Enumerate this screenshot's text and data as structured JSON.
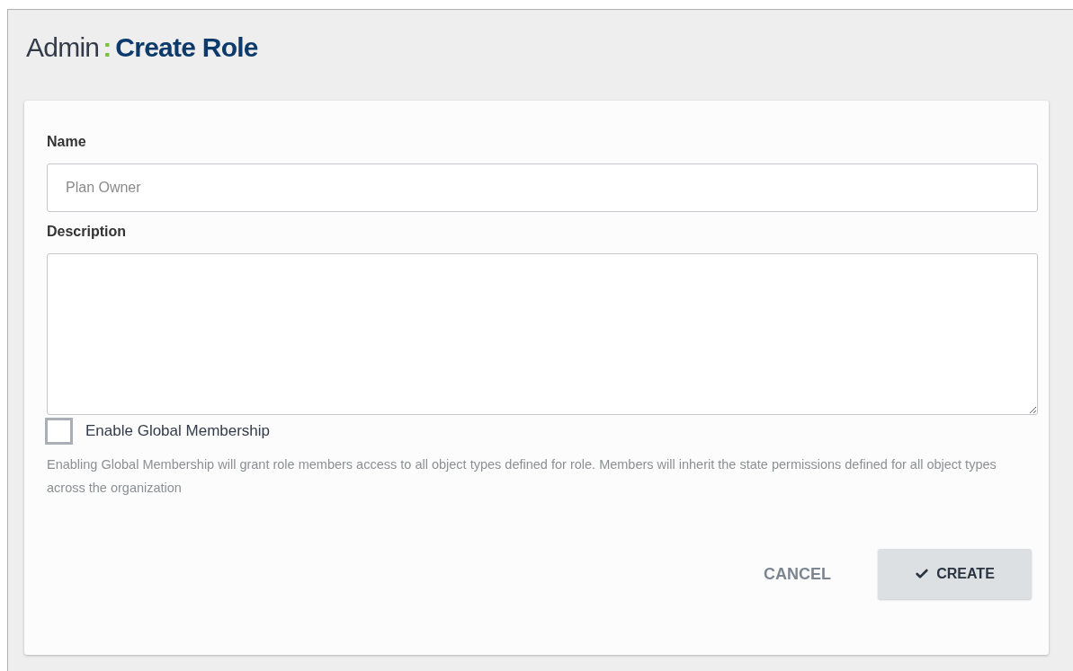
{
  "header": {
    "section": "Admin",
    "separator": ":",
    "title": "Create Role"
  },
  "form": {
    "name_field": {
      "label": "Name",
      "placeholder": "Plan Owner"
    },
    "description_field": {
      "label": "Description"
    },
    "global_membership": {
      "label": "Enable Global Membership",
      "checked": false,
      "help": "Enabling Global Membership will grant role members access to all object types defined for role. Members will inherit the state permissions defined for all object types across the organization"
    },
    "buttons": [
      {
        "kind": "text",
        "label": "CANCEL"
      },
      {
        "kind": "primary",
        "label": "CREATE"
      }
    ]
  }
}
